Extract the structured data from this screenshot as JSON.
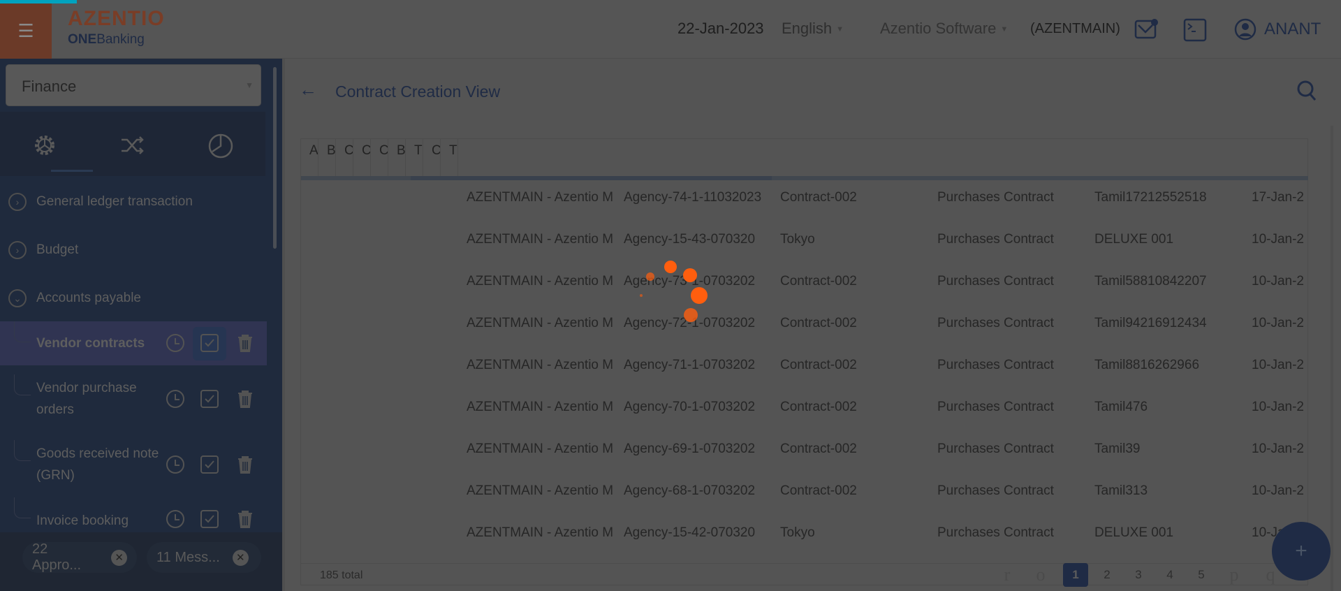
{
  "header": {
    "logo_brand": "AZENTIO",
    "logo_product_bold": "ONE",
    "logo_product": "Banking",
    "date": "22-Jan-2023",
    "language": "English",
    "company": "Azentio Software",
    "branch": "(AZENTMAIN)",
    "user": "ANANT"
  },
  "sidebar": {
    "module": "Finance",
    "menu": [
      {
        "label": "General ledger transaction",
        "state": "collapsed"
      },
      {
        "label": "Budget",
        "state": "collapsed"
      },
      {
        "label": "Accounts payable",
        "state": "expanded"
      }
    ],
    "subitems": [
      {
        "label": "Vendor contracts",
        "selected": true
      },
      {
        "label": "Vendor purchase orders"
      },
      {
        "label": "Goods received note (GRN)"
      },
      {
        "label": "Invoice booking"
      }
    ],
    "chips": [
      {
        "label": "22 Appro..."
      },
      {
        "label": "11 Mess..."
      }
    ]
  },
  "page": {
    "title": "Contract Creation View",
    "column_headers": [
      "A",
      "B",
      "C",
      "C",
      "C",
      "B",
      "T",
      "C",
      "T"
    ],
    "rows": [
      [
        "AZENTMAIN - Azentio M",
        "Agency-74-1-11032023",
        "Contract-002",
        "Purchases Contract",
        "Tamil17212552518",
        "17-Jan-2"
      ],
      [
        "AZENTMAIN - Azentio M",
        "Agency-15-43-070320",
        "Tokyo",
        "Purchases Contract",
        "DELUXE 001",
        "10-Jan-2"
      ],
      [
        "AZENTMAIN - Azentio M",
        "Agency-73-1-0703202",
        "Contract-002",
        "Purchases Contract",
        "Tamil58810842207",
        "10-Jan-2"
      ],
      [
        "AZENTMAIN - Azentio M",
        "Agency-72-1-0703202",
        "Contract-002",
        "Purchases Contract",
        "Tamil94216912434",
        "10-Jan-2"
      ],
      [
        "AZENTMAIN - Azentio M",
        "Agency-71-1-0703202",
        "Contract-002",
        "Purchases Contract",
        "Tamil8816262966",
        "10-Jan-2"
      ],
      [
        "AZENTMAIN - Azentio M",
        "Agency-70-1-0703202",
        "Contract-002",
        "Purchases Contract",
        "Tamil476",
        "10-Jan-2"
      ],
      [
        "AZENTMAIN - Azentio M",
        "Agency-69-1-0703202",
        "Contract-002",
        "Purchases Contract",
        "Tamil39",
        "10-Jan-2"
      ],
      [
        "AZENTMAIN - Azentio M",
        "Agency-68-1-0703202",
        "Contract-002",
        "Purchases Contract",
        "Tamil313",
        "10-Jan-2"
      ],
      [
        "AZENTMAIN - Azentio M",
        "Agency-15-42-070320",
        "Tokyo",
        "Purchases Contract",
        "DELUXE 001",
        "10-Jan-2"
      ]
    ],
    "total": "185 total",
    "pagination": {
      "first": "r",
      "prev": "o",
      "pages": [
        "1",
        "2",
        "3",
        "4",
        "5"
      ],
      "current": "1",
      "next": "p",
      "last": "q"
    },
    "fab": "+"
  },
  "colors": {
    "accent": "#1f2b45",
    "brand": "#7a3d26",
    "spinner": "#ff5e0e",
    "topline": "#00a3bf"
  }
}
